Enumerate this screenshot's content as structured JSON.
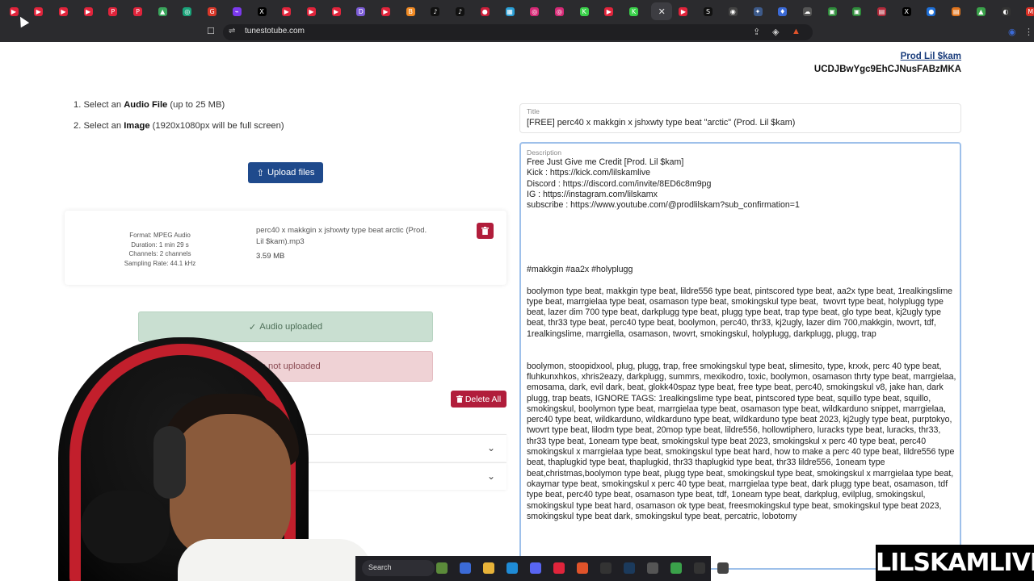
{
  "browser": {
    "url": "tunestotube.com",
    "tabs": [
      {
        "icon": "youtube-icon",
        "color": "#e0243b",
        "glyph": "▶"
      },
      {
        "icon": "youtube-icon",
        "color": "#e0243b",
        "glyph": "▶"
      },
      {
        "icon": "youtube-icon",
        "color": "#e0243b",
        "glyph": "▶"
      },
      {
        "icon": "youtube-icon",
        "color": "#e0243b",
        "glyph": "▶"
      },
      {
        "icon": "pinterest-icon",
        "color": "#e0243b",
        "glyph": "P"
      },
      {
        "icon": "pinterest-icon",
        "color": "#e0243b",
        "glyph": "P"
      },
      {
        "icon": "drive-icon",
        "color": "#3aa55c",
        "glyph": "▲"
      },
      {
        "icon": "chatgpt-icon",
        "color": "#1aa37a",
        "glyph": "◎"
      },
      {
        "icon": "app-icon",
        "color": "#d9382a",
        "glyph": "G"
      },
      {
        "icon": "app-icon",
        "color": "#7c3aed",
        "glyph": "⌁"
      },
      {
        "icon": "x-icon",
        "color": "#000000",
        "glyph": "X"
      },
      {
        "icon": "youtube-icon",
        "color": "#e0243b",
        "glyph": "▶"
      },
      {
        "icon": "youtube-icon",
        "color": "#e0243b",
        "glyph": "▶"
      },
      {
        "icon": "youtube-icon",
        "color": "#e0243b",
        "glyph": "▶"
      },
      {
        "icon": "app-icon",
        "color": "#7c5cd6",
        "glyph": "D"
      },
      {
        "icon": "youtube-icon",
        "color": "#e0243b",
        "glyph": "▶"
      },
      {
        "icon": "app-icon",
        "color": "#f08a24",
        "glyph": "B"
      },
      {
        "icon": "tiktok-icon",
        "color": "#111111",
        "glyph": "♪"
      },
      {
        "icon": "tiktok-icon",
        "color": "#111111",
        "glyph": "♪"
      },
      {
        "icon": "app-icon",
        "color": "#cc1f3a",
        "glyph": "●"
      },
      {
        "icon": "app-icon",
        "color": "#2a9fd6",
        "glyph": "▦"
      },
      {
        "icon": "instagram-icon",
        "color": "#d62976",
        "glyph": "◎"
      },
      {
        "icon": "instagram-icon",
        "color": "#d62976",
        "glyph": "◎"
      },
      {
        "icon": "kick-icon",
        "color": "#3ad14a",
        "glyph": "K"
      },
      {
        "icon": "youtube-icon",
        "color": "#e0243b",
        "glyph": "▶"
      },
      {
        "icon": "kick-icon",
        "color": "#3ad14a",
        "glyph": "K"
      },
      {
        "icon": "close-icon",
        "color": "",
        "glyph": "✕"
      },
      {
        "icon": "youtube-icon",
        "color": "#e0243b",
        "glyph": "▶"
      },
      {
        "icon": "app-icon",
        "color": "#111111",
        "glyph": "S"
      },
      {
        "icon": "app-icon",
        "color": "#444444",
        "glyph": "◉"
      },
      {
        "icon": "app-icon",
        "color": "#3d5a8a",
        "glyph": "✦"
      },
      {
        "icon": "app-icon",
        "color": "#3b6ad6",
        "glyph": "♦"
      },
      {
        "icon": "cloud-icon",
        "color": "#555555",
        "glyph": "☁"
      },
      {
        "icon": "app-icon",
        "color": "#2e8b3a",
        "glyph": "▣"
      },
      {
        "icon": "app-icon",
        "color": "#2e8b3a",
        "glyph": "▣"
      },
      {
        "icon": "app-icon",
        "color": "#b02a3a",
        "glyph": "▤"
      },
      {
        "icon": "x-icon",
        "color": "#000000",
        "glyph": "X"
      },
      {
        "icon": "app-icon",
        "color": "#1f6fd6",
        "glyph": "●"
      },
      {
        "icon": "app-icon",
        "color": "#e0741d",
        "glyph": "▤"
      },
      {
        "icon": "app-icon",
        "color": "#3aa14a",
        "glyph": "▲"
      },
      {
        "icon": "app-icon",
        "color": "#333333",
        "glyph": "◐"
      },
      {
        "icon": "gmail-icon",
        "color": "#d93025",
        "glyph": "M"
      }
    ]
  },
  "channel": {
    "name": "Prod Lil $kam",
    "id": "UCDJBwYgc9EhCJNusFABzMKA"
  },
  "instructions": {
    "step1_prefix": "1. Select an ",
    "step1_bold": "Audio File",
    "step1_suffix": " (up to 25 MB)",
    "step2_prefix": "2. Select an ",
    "step2_bold": "Image",
    "step2_suffix": " (1920x1080px will be full screen)"
  },
  "upload_button": {
    "label": "Upload files",
    "icon": "upload-icon"
  },
  "file": {
    "format": "Format: MPEG Audio",
    "duration": "Duration: 1 min 29 s",
    "channels": "Channels: 2 channels",
    "sampling": "Sampling Rate: 44.1 kHz",
    "name": "perc40 x makkgin x jshxwty type beat arctic (Prod. Lil $kam).mp3",
    "size": "3.59 MB"
  },
  "status": {
    "audio": "Audio uploaded",
    "image": "age not uploaded",
    "audio_icon": "check-icon"
  },
  "delete_all": {
    "label": "Delete All"
  },
  "title_field": {
    "label": "Title",
    "value": "[FREE] perc40 x makkgin x jshxwty type beat \"arctic\" (Prod. Lil $kam)"
  },
  "description_field": {
    "label": "Description",
    "value": "Free Just Give me Credit [Prod. Lil $kam]\nKick : https://kick.com/lilskamlive\nDiscord : https://discord.com/invite/8ED6c8m9pg\nIG : https://instagram.com/lilskamx\nsubscribe : https://www.youtube.com/@prodlilskam?sub_confirmation=1\n\n\n\n\n\n#makkgin #aa2x #holyplugg\n\nboolymon type beat, makkgin type beat, lildre556 type beat, pintscored type beat, aa2x type beat, 1realkingslime type beat, marrgielaa type beat, osamason type beat, smokingskul type beat,  twovrt type beat, holyplugg type beat, lazer dim 700 type beat, darkplugg type beat, plugg type beat, trap type beat, glo type beat, kj2ugly type beat, thr33 type beat, perc40 type beat, boolymon, perc40, thr33, kj2ugly, lazer dim 700,makkgin, twovrt, tdf, 1realkingslime, marrgiella, osamason, twovrt, smokingskul, holyplugg, darkplugg, plugg, trap\n\n\nboolymon, stoopidxool, plug, plugg, trap, free smokingskul type beat, slimesito, type, krxxk, perc 40 type beat, fluhkunxhkos, xhris2eazy, darkplugg, summrs, mexikodro, toxic, boolymon, osamason thrty type beat, marrgielaa, emosama, dark, evil dark, beat, glokk40spaz type beat, free type beat, perc40, smokingskul v8, jake han, dark plugg, trap beats, IGNORE TAGS: 1realkingslime type beat, pintscored type beat, squillo type beat, squillo, smokingskul, boolymon type beat, marrgielaa type beat, osamason type beat, wildkarduno snippet, marrgielaa, perc40 type beat, wildkarduno, wildkarduno type beat, wildkarduno type beat 2023, kj2ugly type beat, purptokyo,  twovrt type beat, lilodm type beat, 20mop type beat, lildre556, hollowtiphero, luracks type beat, luracks, thr33, thr33 type beat, 1oneam type beat, smokingskul type beat 2023, smokingskul x perc 40 type beat, perc40 smokingskul x marrgielaa type beat, smokingskul type beat hard, how to make a perc 40 type beat, lildre556 type beat, thaplugkid type beat, thaplugkid, thr33 thaplugkid type beat, thr33 lildre556, 1oneam type beat,christmas,boolymon type beat, plugg type beat, smokingskul type beat, smokingskul x marrgielaa type beat, okaymar type beat, smokingskul x perc 40 type beat, marrgielaa type beat, dark plugg type beat, osamason, tdf type beat, perc40 type beat, osamason type beat, tdf, 1oneam type beat, darkplug, evilplug, smokingskul, smokingskul type beat hard, osamason ok type beat, freesmokingskul type beat, smokingskul type beat 2023, smokingskul type beat dark, smokingskul type beat, percatric, lobotomy"
  },
  "accordions": [
    {
      "name": "accordion-1",
      "icon": "chevron-down-icon"
    },
    {
      "name": "accordion-2",
      "icon": "chevron-down-icon"
    }
  ],
  "taskbar": {
    "search_label": "Search",
    "icons": [
      {
        "icon": "widgets-icon",
        "color": "#5b8a3a"
      },
      {
        "icon": "copilot-icon",
        "color": "#3b6ad6"
      },
      {
        "icon": "folder-icon",
        "color": "#e8b339"
      },
      {
        "icon": "edge-icon",
        "color": "#1f8bd6"
      },
      {
        "icon": "discord-icon",
        "color": "#5865f2"
      },
      {
        "icon": "app-icon",
        "color": "#e0243b"
      },
      {
        "icon": "brave-icon",
        "color": "#e0532a"
      },
      {
        "icon": "obs-icon",
        "color": "#333333"
      },
      {
        "icon": "steam-icon",
        "color": "#1b3a5c"
      },
      {
        "icon": "app-icon",
        "color": "#555555"
      },
      {
        "icon": "app-icon",
        "color": "#3aa14a"
      },
      {
        "icon": "app-icon",
        "color": "#333333"
      },
      {
        "icon": "app-icon",
        "color": "#444444"
      }
    ]
  },
  "watermark": "LILSKAMLIVE"
}
